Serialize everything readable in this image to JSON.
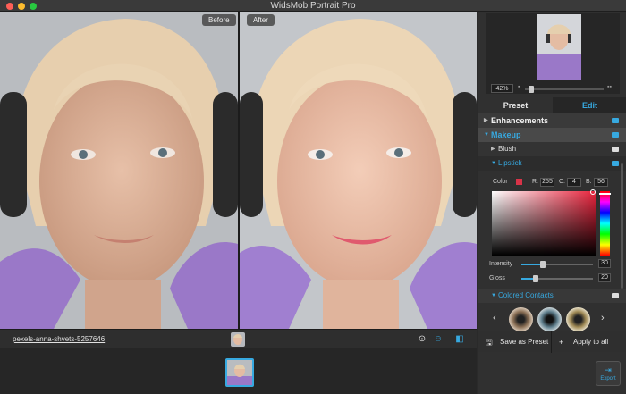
{
  "window": {
    "title": "WidsMob Portrait Pro"
  },
  "viewer": {
    "before_label": "Before",
    "after_label": "After"
  },
  "filebar": {
    "filename": "pexels-anna-shvets-5257646"
  },
  "preview": {
    "zoom": "42%"
  },
  "tabs": {
    "preset": "Preset",
    "edit": "Edit"
  },
  "sections": {
    "enhancements": "Enhancements",
    "makeup": "Makeup",
    "blush": "Blush",
    "lipstick": "Lipstick",
    "colored_contacts": "Colored Contacts"
  },
  "lipstick": {
    "color_label": "Color",
    "r_label": "R:",
    "r": "255",
    "c_label": "C:",
    "c": "4",
    "b_label": "B:",
    "b": "56",
    "swatch_color": "#d93348",
    "intensity_label": "Intensity",
    "intensity": "30",
    "intensity_fraction": 0.3,
    "gloss_label": "Gloss",
    "gloss": "20",
    "gloss_fraction": 0.2
  },
  "buttons": {
    "save_preset": "Save as Preset",
    "apply_all": "Apply to all",
    "export": "Export"
  },
  "colors": {
    "accent": "#37a9e0",
    "panel": "#303030"
  },
  "icons": [
    "close-icon",
    "minimize-icon",
    "zoom-icon",
    "face-detect-icon",
    "smile-icon",
    "compare-icon",
    "save-icon",
    "plus-icon",
    "export-icon",
    "chevron-left-icon",
    "chevron-right-icon"
  ]
}
